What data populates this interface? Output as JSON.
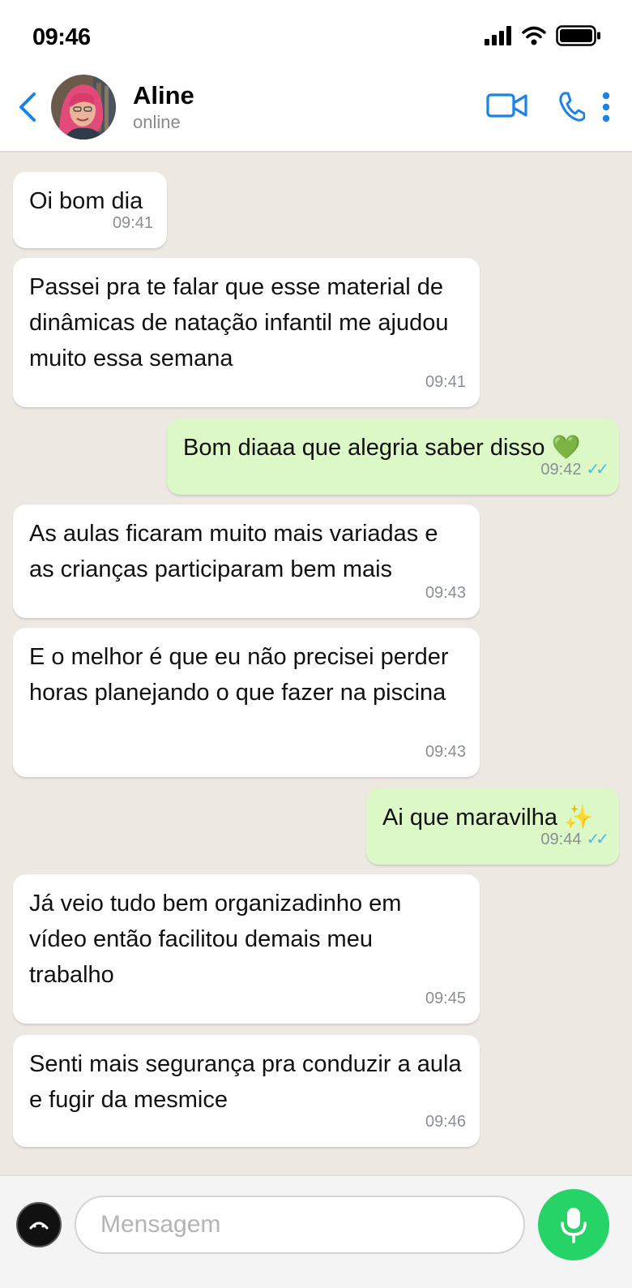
{
  "status_bar": {
    "time": "09:46"
  },
  "header": {
    "contact_name": "Aline",
    "contact_status": "online"
  },
  "messages": [
    {
      "direction": "in",
      "text": "Oi bom dia",
      "time": "09:41"
    },
    {
      "direction": "in",
      "text": "Passei pra te falar que esse material de dinâmicas de natação infantil me ajudou muito essa semana",
      "time": "09:41"
    },
    {
      "direction": "out",
      "text": "Bom diaaa que alegria saber disso 💚",
      "time": "09:42",
      "ticks": "✓✓"
    },
    {
      "direction": "in",
      "text": "As aulas ficaram muito mais variadas e as crianças participaram bem mais",
      "time": "09:43"
    },
    {
      "direction": "in",
      "text": "E o melhor é que eu não precisei perder horas planejando o que fazer na piscina",
      "time": "09:43"
    },
    {
      "direction": "out",
      "text": "Ai que maravilha ✨",
      "time": "09:44",
      "ticks": "✓✓"
    },
    {
      "direction": "in",
      "text": "Já veio tudo bem organizadinho em vídeo então facilitou demais meu trabalho",
      "time": "09:45"
    },
    {
      "direction": "in",
      "text": "Senti mais segurança pra conduzir a aula e fugir da mesmice",
      "time": "09:46"
    }
  ],
  "input": {
    "placeholder": "Mensagem"
  },
  "colors": {
    "accent": "#1a82e8",
    "outgoing_bubble": "#dcf8c6",
    "chat_background": "#ede8e2",
    "mic_button": "#25d366",
    "read_ticks": "#4fb6ec"
  },
  "icons": {
    "back": "chevron-left-icon",
    "video": "video-camera-icon",
    "call": "phone-icon",
    "more": "more-vertical-icon",
    "emoji": "emoji-icon",
    "mic": "microphone-icon",
    "signal": "signal-icon",
    "wifi": "wifi-icon",
    "battery": "battery-icon"
  }
}
